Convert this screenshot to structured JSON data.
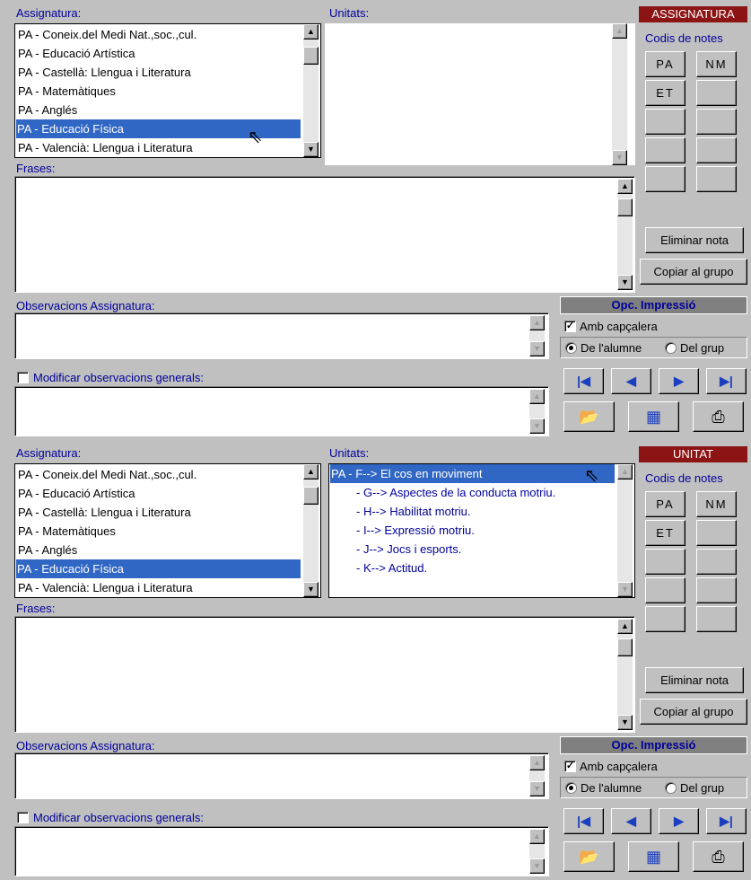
{
  "panels": [
    {
      "assignatura_label": "Assignatura:",
      "unitats_label": "Unitats:",
      "mode_title": "ASSIGNATURA",
      "subjects": [
        "PA - Coneix.del Medi Nat.,soc.,cul.",
        "PA - Educació Artística",
        "PA - Castellà: Llengua i Literatura",
        "PA - Matemàtiques",
        "PA - Anglés",
        "PA - Educació Física",
        "PA - Valencià: Llengua i Literatura"
      ],
      "selected_subject_index": 5,
      "units": [],
      "codis_label": "Codis de notes",
      "codes": [
        "PA",
        "NM",
        "ET",
        "",
        "",
        "",
        "",
        "",
        "",
        ""
      ],
      "eliminar_label": "Eliminar nota",
      "copiar_label": "Copiar al grupo",
      "frases_label": "Frases:",
      "frases_value": "",
      "obs_label": "Observacions Assignatura:",
      "obs_value": "",
      "modificar_label": "Modificar observacions generals:",
      "modificar_checked": false,
      "print_title": "Opc. Impressió",
      "amb_capcalera_label": "Amb capçalera",
      "amb_capcalera_checked": true,
      "radio_alumne_label": "De l'alumne",
      "radio_grup_label": "Del grup",
      "radio_selected": "alumne"
    },
    {
      "assignatura_label": "Assignatura:",
      "unitats_label": "Unitats:",
      "mode_title": "UNITAT",
      "subjects": [
        "PA - Coneix.del Medi Nat.,soc.,cul.",
        "PA - Educació Artística",
        "PA - Castellà: Llengua i Literatura",
        "PA - Matemàtiques",
        "PA - Anglés",
        "PA - Educació Física",
        "PA - Valencià: Llengua i Literatura"
      ],
      "selected_subject_index": 5,
      "units": [
        "PA - F--> El cos en moviment",
        "- G--> Aspectes de la conducta motriu.",
        "- H--> Habilitat motriu.",
        "- I--> Expressió motriu.",
        "- J--> Jocs i esports.",
        "- K--> Actitud."
      ],
      "codis_label": "Codis de notes",
      "codes": [
        "PA",
        "NM",
        "ET",
        "",
        "",
        "",
        "",
        "",
        "",
        ""
      ],
      "eliminar_label": "Eliminar nota",
      "copiar_label": "Copiar al grupo",
      "frases_label": "Frases:",
      "frases_value": "",
      "obs_label": "Observacions Assignatura:",
      "obs_value": "",
      "modificar_label": "Modificar observacions generals:",
      "modificar_checked": false,
      "print_title": "Opc. Impressió",
      "amb_capcalera_label": "Amb capçalera",
      "amb_capcalera_checked": true,
      "radio_alumne_label": "De l'alumne",
      "radio_grup_label": "Del grup",
      "radio_selected": "alumne"
    }
  ],
  "icons": {
    "first": "first-record-icon",
    "prev": "previous-record-icon",
    "next": "next-record-icon",
    "last": "last-record-icon",
    "open": "open-folder-icon",
    "preview": "print-preview-icon",
    "print": "printer-icon"
  },
  "colors": {
    "selection": "#3167c4",
    "label_blue": "#00009a",
    "title_red": "#8c1414"
  }
}
